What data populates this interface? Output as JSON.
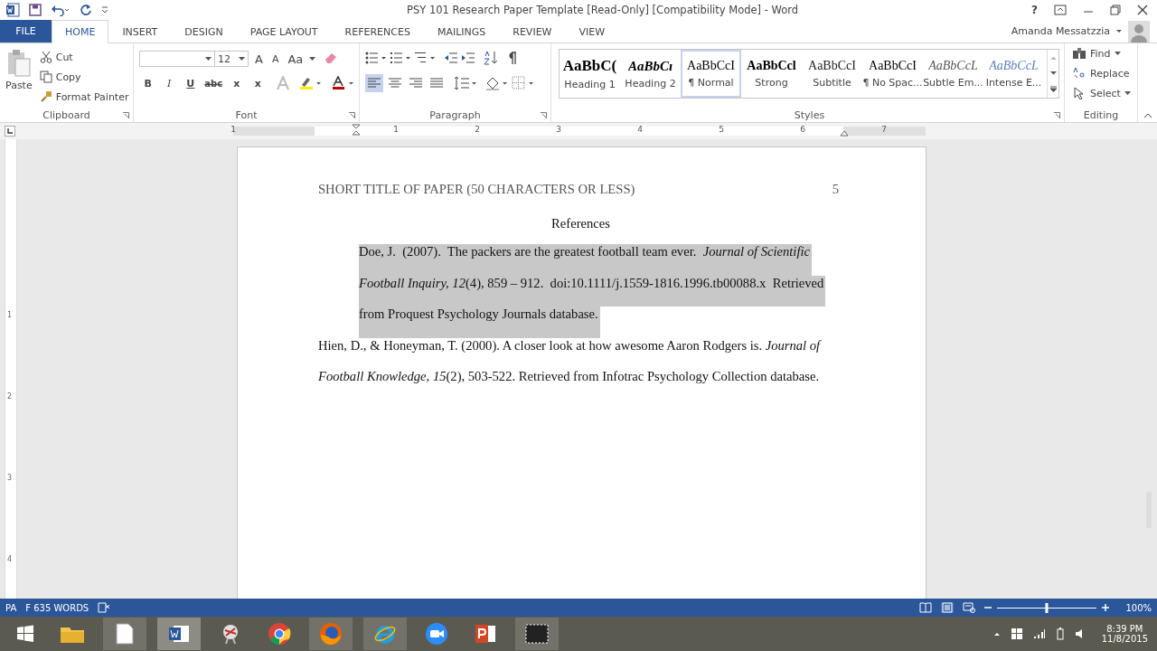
{
  "window": {
    "title": "PSY 101 Research Paper Template [Read-Only] [Compatibility Mode] - Word",
    "help": "?",
    "user": "Amanda Messatzzia"
  },
  "tabs": [
    {
      "label": "FILE",
      "selected": false,
      "kind": "file"
    },
    {
      "label": "HOME",
      "selected": true,
      "kind": "tab"
    },
    {
      "label": "INSERT",
      "selected": false,
      "kind": "tab"
    },
    {
      "label": "DESIGN",
      "selected": false,
      "kind": "tab"
    },
    {
      "label": "PAGE LAYOUT",
      "selected": false,
      "kind": "tab"
    },
    {
      "label": "REFERENCES",
      "selected": false,
      "kind": "tab"
    },
    {
      "label": "MAILINGS",
      "selected": false,
      "kind": "tab"
    },
    {
      "label": "REVIEW",
      "selected": false,
      "kind": "tab"
    },
    {
      "label": "VIEW",
      "selected": false,
      "kind": "tab"
    }
  ],
  "ribbon": {
    "clipboard": {
      "label": "Clipboard",
      "paste": "Paste",
      "items": [
        "Cut",
        "Copy",
        "Format Painter"
      ]
    },
    "font": {
      "label": "Font",
      "size": "12",
      "grow": "A",
      "shrink": "A",
      "case": "Aa",
      "format_buttons": [
        "B",
        "I",
        "U",
        "abc",
        "x",
        "x"
      ]
    },
    "paragraph": {
      "label": "Paragraph",
      "alignments": [
        {
          "selected": true
        },
        {
          "selected": false
        },
        {
          "selected": false
        },
        {
          "selected": false
        }
      ]
    },
    "styles": {
      "label": "Styles",
      "items": [
        {
          "preview": "AaBbC(",
          "name": "Heading 1",
          "kind": "heading1",
          "selected": false
        },
        {
          "preview": "AaBbCı",
          "name": "Heading 2",
          "kind": "heading2",
          "selected": false
        },
        {
          "preview": "AaBbCcI",
          "name": "¶ Normal",
          "kind": "normal",
          "selected": true
        },
        {
          "preview": "AaBbCcl",
          "name": "Strong",
          "kind": "strong",
          "selected": false
        },
        {
          "preview": "AaBbCcI",
          "name": "Subtitle",
          "kind": "subtitle",
          "selected": false
        },
        {
          "preview": "AaBbCcI",
          "name": "¶ No Spac...",
          "kind": "nospacing",
          "selected": false
        },
        {
          "preview": "AaBbCcL",
          "name": "Subtle Em...",
          "kind": "subtle",
          "selected": false
        },
        {
          "preview": "AaBbCcL",
          "name": "Intense E...",
          "kind": "intense",
          "selected": false
        }
      ]
    },
    "editing": {
      "label": "Editing",
      "items": [
        "Find",
        "Replace",
        "Select"
      ]
    }
  },
  "ruler": {
    "numbers": [
      "1",
      "1",
      "2",
      "3",
      "4",
      "5",
      "6",
      "7"
    ],
    "vertical_numbers": [
      "1",
      "2",
      "3",
      "4"
    ]
  },
  "document": {
    "header_title": "SHORT TITLE OF PAPER (50 CHARACTERS OR LESS)",
    "page_number": "5",
    "heading": "References",
    "references": [
      {
        "selected": true,
        "lines": [
          "Doe, J.  (2007).  The packers are the greatest football team ever.  *Journal of Scientific*",
          "*Football Inquiry, 12*(4), 859 – 912.  doi:10.1111/j.1559-1816.1996.tb00088.x  Retrieved",
          "from Proquest Psychology Journals database."
        ]
      },
      {
        "selected": false,
        "lines": [
          "Hien, D., & Honeyman, T. (2000). A closer look at how awesome Aaron Rodgers is. *Journal of*",
          "*Football Knowledge, 15*(2), 503-522. Retrieved from Infotrac Psychology Collection database."
        ]
      }
    ]
  },
  "status_bar": {
    "texts": [
      "PA",
      "F 635 WORDS"
    ],
    "zoom": {
      "level": 0.5
    },
    "zoom_reading": "100%"
  },
  "taskbar": {
    "time": "8:39 PM",
    "date": "11/8/2015"
  }
}
